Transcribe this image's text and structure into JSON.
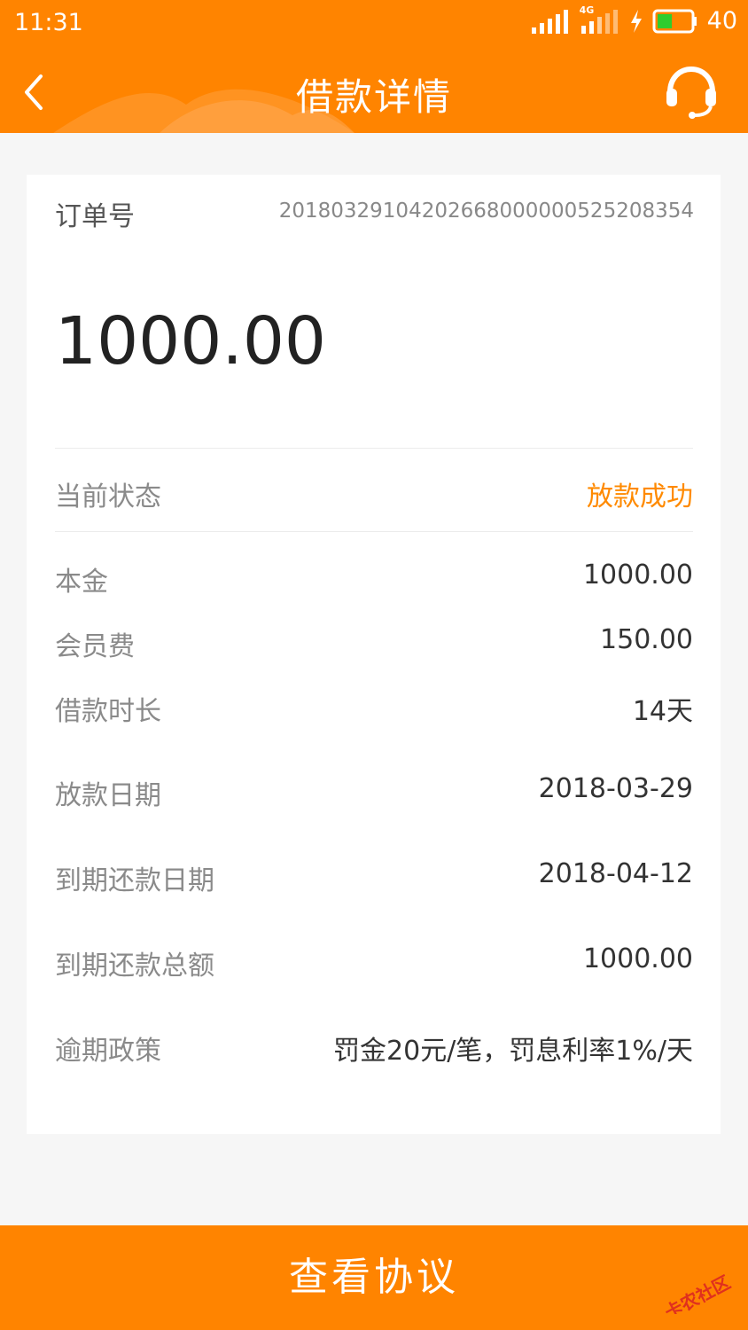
{
  "status_bar": {
    "time": "11:31",
    "network_label": "4G",
    "battery_level": "40"
  },
  "nav": {
    "title": "借款详情",
    "back_icon": "chevron-left-icon",
    "service_icon": "headset-icon"
  },
  "card": {
    "order_label": "订单号",
    "order_number": "20180329104202668000000525208354",
    "amount": "1000.00",
    "status": {
      "label": "当前状态",
      "value": "放款成功"
    },
    "details": [
      {
        "label": "本金",
        "value": "1000.00"
      },
      {
        "label": "会员费",
        "value": "150.00"
      },
      {
        "label": "借款时长",
        "value": "14天"
      },
      {
        "label": "放款日期",
        "value": "2018-03-29"
      },
      {
        "label": "到期还款日期",
        "value": "2018-04-12"
      },
      {
        "label": "到期还款总额",
        "value": "1000.00"
      },
      {
        "label": "逾期政策",
        "value": "罚金20元/笔，罚息利率1%/天"
      }
    ]
  },
  "footer": {
    "button_label": "查看协议"
  },
  "watermark": {
    "text": "卡农社区"
  },
  "colors": {
    "accent": "#ff8400",
    "status_text": "#ff8a00",
    "background": "#f6f6f6"
  }
}
